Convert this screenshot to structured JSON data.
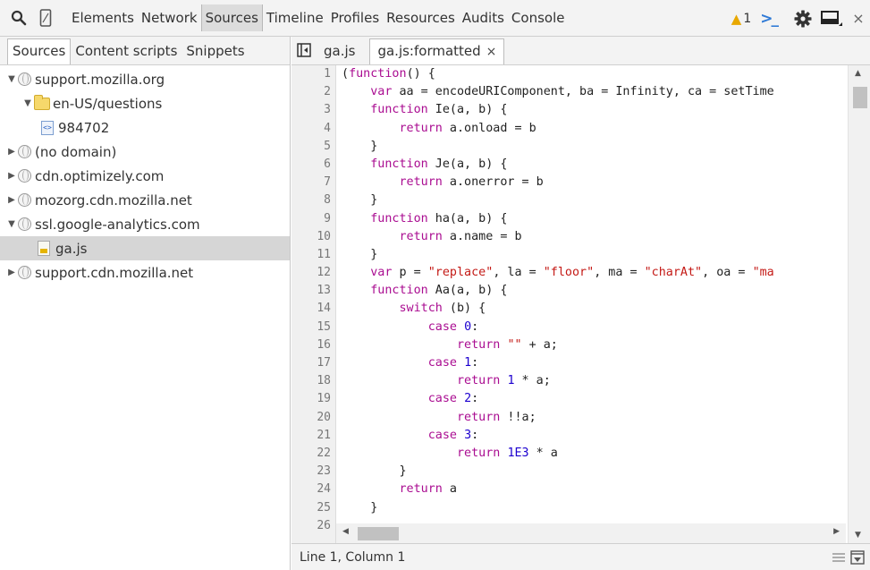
{
  "toolbar": {
    "tabs": [
      "Elements",
      "Network",
      "Sources",
      "Timeline",
      "Profiles",
      "Resources",
      "Audits",
      "Console"
    ],
    "active_tab": "Sources",
    "warning_count": "1",
    "icons": [
      "search-icon",
      "device-mode-icon",
      "warning-icon",
      "console-drawer-icon",
      "gear-icon",
      "dock-icon",
      "close-icon"
    ]
  },
  "left_panel": {
    "tabs": [
      "Sources",
      "Content scripts",
      "Snippets"
    ],
    "tree": [
      {
        "label": "support.mozilla.org",
        "type": "domain",
        "expanded": true
      },
      {
        "label": "en-US/questions",
        "type": "folder",
        "expanded": true
      },
      {
        "label": "984702",
        "type": "html-file"
      },
      {
        "label": "(no domain)",
        "type": "domain",
        "expanded": false
      },
      {
        "label": "cdn.optimizely.com",
        "type": "domain",
        "expanded": false
      },
      {
        "label": "mozorg.cdn.mozilla.net",
        "type": "domain",
        "expanded": false
      },
      {
        "label": "ssl.google-analytics.com",
        "type": "domain",
        "expanded": true
      },
      {
        "label": "ga.js",
        "type": "js-file",
        "selected": true
      },
      {
        "label": "support.cdn.mozilla.net",
        "type": "domain",
        "expanded": false
      }
    ]
  },
  "editor": {
    "tabs": [
      {
        "label": "ga.js",
        "active": false
      },
      {
        "label": "ga.js:formatted",
        "active": true,
        "close": "×"
      }
    ],
    "line_numbers": [
      "1",
      "2",
      "3",
      "4",
      "5",
      "6",
      "7",
      "8",
      "9",
      "10",
      "11",
      "12",
      "13",
      "14",
      "15",
      "16",
      "17",
      "18",
      "19",
      "20",
      "21",
      "22",
      "23",
      "24",
      "25",
      "26"
    ],
    "code_lines": [
      "(function() {",
      "    var aa = encodeURIComponent, ba = Infinity, ca = setTime",
      "    function Ie(a, b) {",
      "        return a.onload = b",
      "    }",
      "    function Je(a, b) {",
      "        return a.onerror = b",
      "    }",
      "    function ha(a, b) {",
      "        return a.name = b",
      "    }",
      "    var p = \"replace\", la = \"floor\", ma = \"charAt\", oa = \"ma",
      "    function Aa(a, b) {",
      "        switch (b) {",
      "            case 0:",
      "                return \"\" + a;",
      "            case 1:",
      "                return 1 * a;",
      "            case 2:",
      "                return !!a;",
      "            case 3:",
      "                return 1E3 * a",
      "        }",
      "        return a",
      "    }",
      ""
    ],
    "status": "Line 1, Column 1"
  },
  "colors": {
    "keyword": "#aa0d91",
    "string": "#c41a16",
    "number": "#1c00cf",
    "warning": "#e8a800",
    "console_accent": "#2f7ad6"
  }
}
